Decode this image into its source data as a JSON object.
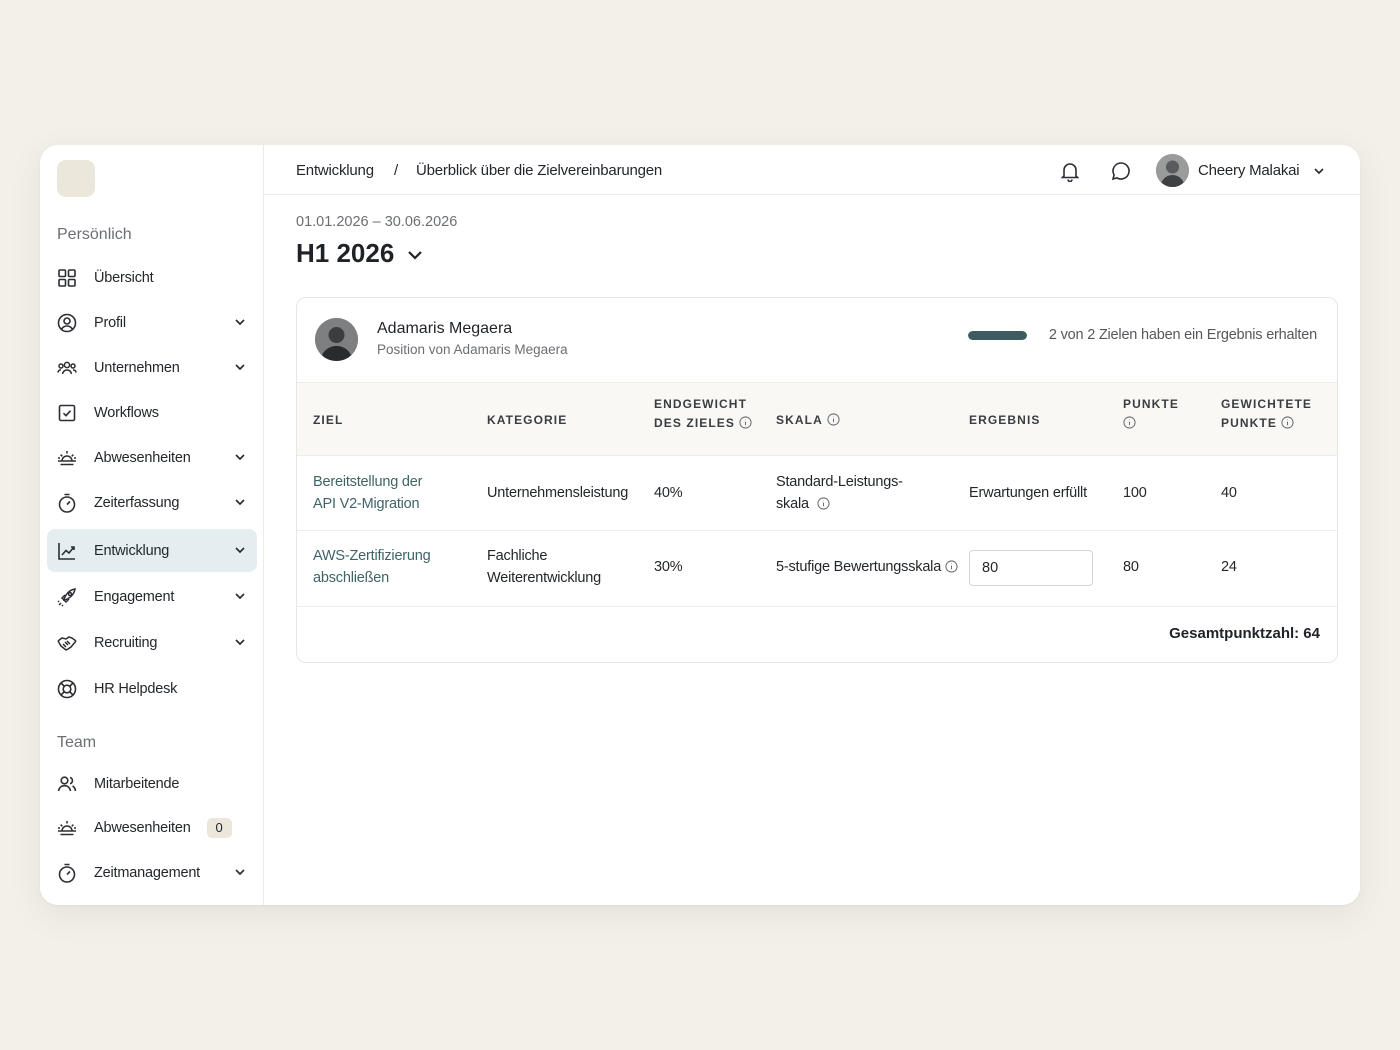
{
  "sidebar": {
    "sections": [
      {
        "title": "Persönlich",
        "items": [
          {
            "label": "Übersicht"
          },
          {
            "label": "Profil"
          },
          {
            "label": "Unternehmen"
          },
          {
            "label": "Workflows"
          },
          {
            "label": "Abwesenheiten"
          },
          {
            "label": "Zeiterfassung"
          },
          {
            "label": "Entwicklung",
            "active": true
          },
          {
            "label": "Engagement"
          },
          {
            "label": "Recruiting"
          },
          {
            "label": "HR Helpdesk"
          }
        ]
      },
      {
        "title": "Team",
        "items": [
          {
            "label": "Mitarbeitende"
          },
          {
            "label": "Abwesenheiten",
            "badge": "0"
          },
          {
            "label": "Zeitmanagement"
          }
        ]
      }
    ]
  },
  "header": {
    "breadcrumb": [
      "Entwicklung",
      "Überblick über die Zielvereinbarungen"
    ],
    "separator": "/",
    "user_name": "Cheery Malakai"
  },
  "period": {
    "date_range": "01.01.2026 – 30.06.2026",
    "title": "H1 2026"
  },
  "employee": {
    "name": "Adamaris Megaera",
    "position": "Position von Adamaris Megaera",
    "progress_text": "2 von 2  Zielen haben ein Ergebnis erhalten",
    "progress_fraction": 1.0
  },
  "table": {
    "headers": {
      "ziel": "ZIEL",
      "kategorie": "KATEGORIE",
      "endgewicht_1": "ENDGEWICHT",
      "endgewicht_2": "DES ZIELES",
      "skala": "SKALA",
      "ergebnis": "ERGEBNIS",
      "punkte": "PUNKTE",
      "gewichtete_1": "GEWICHTETE",
      "gewichtete_2": "PUNKTE"
    },
    "rows": [
      {
        "ziel_1": "Bereitstellung der",
        "ziel_2": "API V2-Migration",
        "kategorie_1": "Unternehmensleistung",
        "kategorie_2": "",
        "gewicht": "40%",
        "skala_1": "Standard-Leistungs-",
        "skala_2": "skala",
        "ergebnis": "Erwartungen erfüllt",
        "punkte": "100",
        "gewichtete": "40"
      },
      {
        "ziel_1": "AWS-Zertifizierung",
        "ziel_2": "abschließen",
        "kategorie_1": "Fachliche",
        "kategorie_2": "Weiterentwicklung",
        "gewicht": "30%",
        "skala_1": "5-stufige Bewertungsskala",
        "skala_2": "",
        "ergebnis_input": "80",
        "punkte": "80",
        "gewichtete": "24"
      }
    ],
    "total": "Gesamtpunktzahl: 64"
  },
  "colors": {
    "accent": "#3e5b60",
    "link": "#3e6468",
    "active_bg": "#e4eef0",
    "page_bg": "#f3f0e9"
  }
}
